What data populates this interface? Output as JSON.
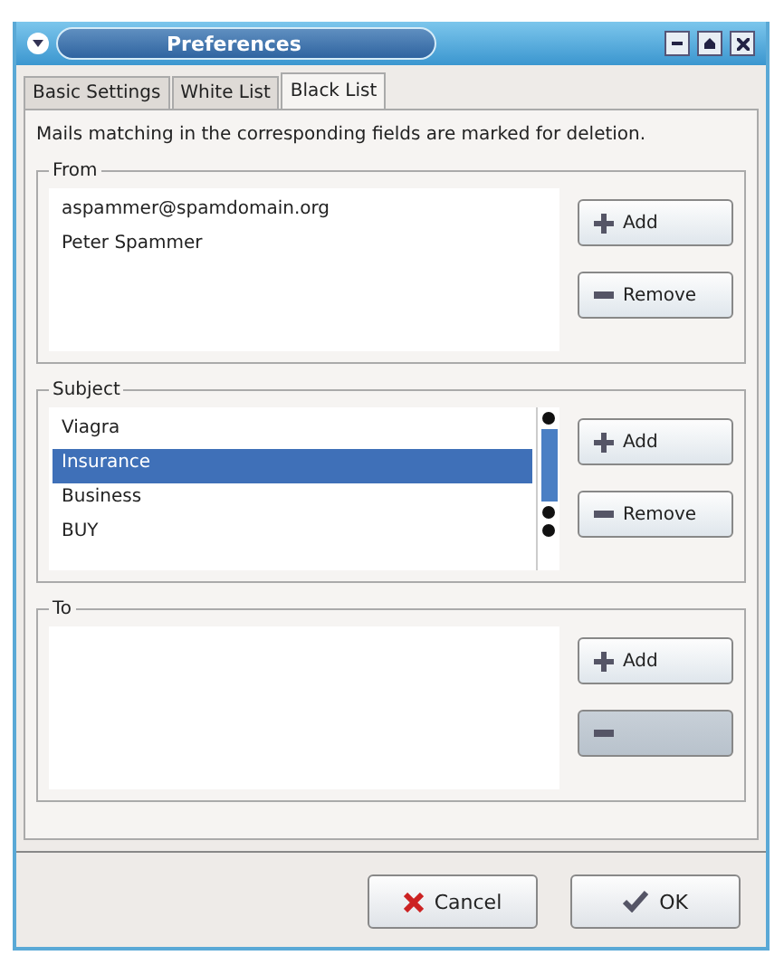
{
  "window": {
    "title": "Preferences"
  },
  "tabs": [
    {
      "label": "Basic Settings",
      "selected": false
    },
    {
      "label": "White List",
      "selected": false
    },
    {
      "label": "Black List",
      "selected": true
    }
  ],
  "description": "Mails matching in the corresponding fields are marked for deletion.",
  "groups": [
    {
      "title": "From",
      "items": [
        {
          "text": "aspammer@spamdomain.org",
          "selected": false
        },
        {
          "text": "Peter Spammer",
          "selected": false
        }
      ],
      "scrollbar": false,
      "buttons": [
        {
          "kind": "add",
          "label": "Add",
          "disabled": false
        },
        {
          "kind": "remove",
          "label": "Remove",
          "disabled": false
        }
      ]
    },
    {
      "title": "Subject",
      "items": [
        {
          "text": "Viagra",
          "selected": false
        },
        {
          "text": "Insurance",
          "selected": true
        },
        {
          "text": "Business",
          "selected": false
        },
        {
          "text": "BUY",
          "selected": false
        }
      ],
      "scrollbar": true,
      "buttons": [
        {
          "kind": "add",
          "label": "Add",
          "disabled": false
        },
        {
          "kind": "remove",
          "label": "Remove",
          "disabled": false
        }
      ]
    },
    {
      "title": "To",
      "scrollbar": false,
      "buttons": [
        {
          "kind": "add",
          "label": "Add",
          "disabled": false
        },
        {
          "kind": "remove",
          "disabled": true
        }
      ]
    }
  ],
  "footer": [
    {
      "kind": "cancel",
      "label": "Cancel"
    },
    {
      "kind": "ok",
      "label": "OK"
    }
  ]
}
